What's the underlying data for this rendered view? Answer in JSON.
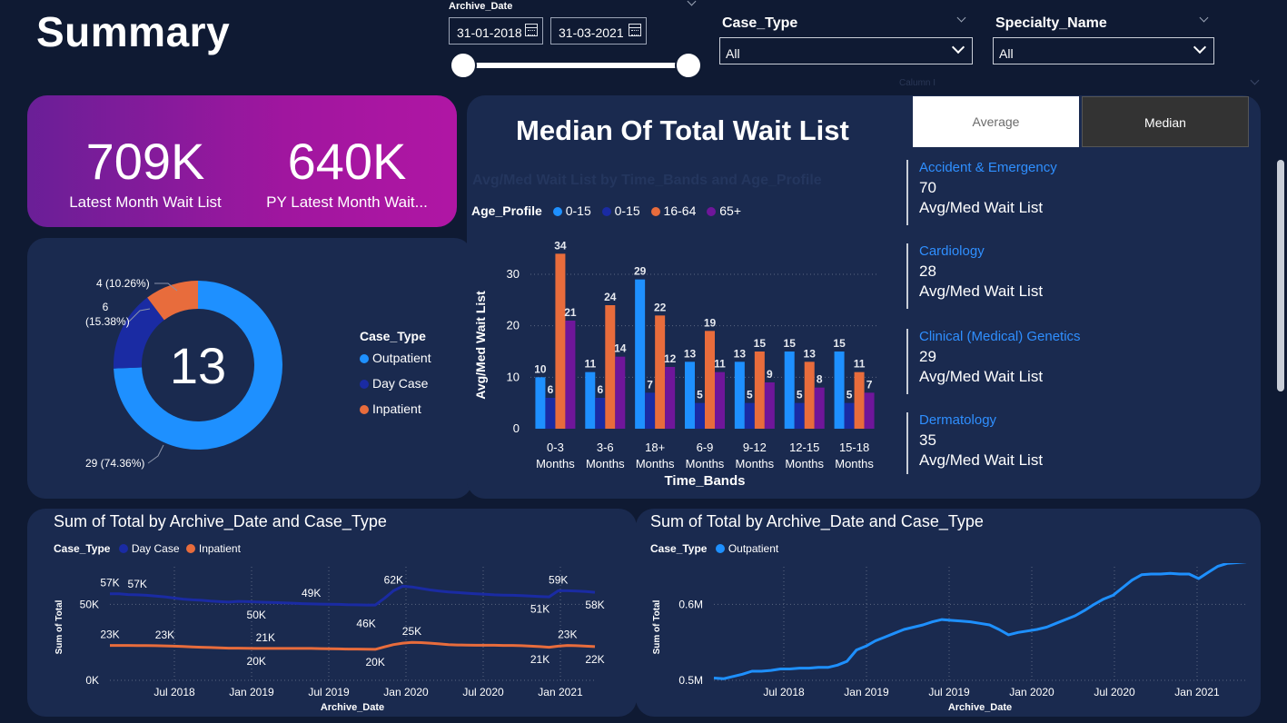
{
  "page_title": "Summary",
  "filters": {
    "archive_date": {
      "label": "Archive_Date",
      "start": "31-01-2018",
      "end": "31-03-2021"
    },
    "case_type": {
      "label": "Case_Type",
      "value": "All"
    },
    "specialty_name": {
      "label": "Specialty_Name",
      "value": "All"
    },
    "hidden_slicer_label": "Calumn I"
  },
  "kpis": [
    {
      "value": "709K",
      "label": "Latest Month Wait List"
    },
    {
      "value": "640K",
      "label": "PY Latest Month Wait..."
    }
  ],
  "donut": {
    "center_value": "13",
    "legend_title": "Case_Type",
    "segments": [
      {
        "name": "Outpatient",
        "value": 29,
        "label": "29 (74.36%)",
        "color": "#1e90ff"
      },
      {
        "name": "Day Case",
        "value": 6,
        "label": "6\n(15.38%)",
        "color": "#1a2ba3"
      },
      {
        "name": "Inpatient",
        "value": 4,
        "label": "4 (10.26%)",
        "color": "#e86c3c"
      }
    ]
  },
  "median_panel": {
    "heading": "Median Of Total Wait List",
    "ghost_title": "Avg/Med Wait List by Time_Bands and Age_Profile",
    "toggle": {
      "average": "Average",
      "median": "Median"
    },
    "specialties": [
      {
        "name": "Accident & Emergency",
        "value": "70",
        "label": "Avg/Med Wait List"
      },
      {
        "name": "Cardiology",
        "value": "28",
        "label": "Avg/Med Wait List"
      },
      {
        "name": "Clinical (Medical) Genetics",
        "value": "29",
        "label": "Avg/Med Wait List"
      },
      {
        "name": "Dermatology",
        "value": "35",
        "label": "Avg/Med Wait List"
      }
    ]
  },
  "colors": {
    "blue": "#1e90ff",
    "navy": "#1a2ba3",
    "orange": "#e86c3c",
    "purple": "#6f169a",
    "accent_text": "#2f8fff"
  },
  "chart_data": [
    {
      "type": "bar",
      "legend_title": "Age_Profile",
      "xlabel": "Time_Bands",
      "ylabel": "Avg/Med Wait List",
      "categories": [
        "0-3 Months",
        "3-6 Months",
        "18+ Months",
        "6-9 Months",
        "9-12 Months",
        "12-15 Months",
        "15-18 Months"
      ],
      "category_lines": [
        [
          "0-3",
          "Months"
        ],
        [
          "3-6",
          "Months"
        ],
        [
          "18+",
          "Months"
        ],
        [
          "6-9",
          "Months"
        ],
        [
          "9-12",
          "Months"
        ],
        [
          "12-15",
          "Months"
        ],
        [
          "15-18",
          "Months"
        ]
      ],
      "ylim": [
        0,
        36
      ],
      "yticks": [
        0,
        10,
        20,
        30
      ],
      "series": [
        {
          "name": "0-15",
          "color": "#1e90ff",
          "values": [
            10,
            11,
            29,
            13,
            13,
            15,
            15
          ]
        },
        {
          "name": "0-15",
          "color": "#1a2ba3",
          "values": [
            6,
            6,
            7,
            5,
            5,
            5,
            5
          ]
        },
        {
          "name": "16-64",
          "color": "#e86c3c",
          "values": [
            34,
            24,
            22,
            19,
            15,
            13,
            11
          ]
        },
        {
          "name": "65+",
          "color": "#6f169a",
          "values": [
            21,
            14,
            12,
            11,
            9,
            8,
            7
          ]
        }
      ]
    },
    {
      "type": "line",
      "title": "Sum of Total by Archive_Date and Case_Type",
      "legend_title": "Case_Type",
      "xlabel": "Archive_Date",
      "ylabel": "Sum of Total",
      "xticks": [
        "Jul 2018",
        "Jan 2019",
        "Jul 2019",
        "Jan 2020",
        "Jul 2020",
        "Jan 2021"
      ],
      "yticks": [
        {
          "value": 0,
          "label": "0K"
        },
        {
          "value": 50000,
          "label": "50K"
        }
      ],
      "ylim": [
        0,
        70000
      ],
      "series": [
        {
          "name": "Day Case",
          "color": "#1a2ba3",
          "values": [
            57000,
            57000,
            56500,
            56300,
            56000,
            55500,
            55000,
            54200,
            53500,
            53000,
            52700,
            52200,
            51800,
            51500,
            52000,
            51800,
            51600,
            51400,
            51200,
            51000,
            50800,
            50500,
            50300,
            50200,
            50100,
            50000,
            49800,
            49700,
            49600,
            49600,
            54000,
            59000,
            62000,
            61500,
            60500,
            59500,
            58800,
            58200,
            57800,
            57400,
            57000,
            56700,
            56300,
            56100,
            56000,
            55800,
            55500,
            55200,
            55000,
            59000,
            59000,
            58800,
            58500,
            58000
          ]
        },
        {
          "name": "Inpatient",
          "color": "#e86c3c",
          "values": [
            23000,
            23000,
            23000,
            22900,
            22900,
            22800,
            22700,
            22500,
            22300,
            22000,
            21800,
            21600,
            21400,
            21200,
            21200,
            21100,
            21000,
            21000,
            21000,
            21000,
            21000,
            21000,
            21000,
            20900,
            20800,
            20700,
            20600,
            20600,
            20500,
            20400,
            22000,
            23500,
            24500,
            25000,
            24800,
            24500,
            24000,
            23500,
            23300,
            23200,
            23100,
            23100,
            23100,
            23000,
            23000,
            22800,
            22500,
            22200,
            21800,
            22500,
            23000,
            22800,
            22500,
            22200
          ]
        }
      ],
      "point_labels": [
        {
          "series": 0,
          "index": 0,
          "text": "57K",
          "pos": "above"
        },
        {
          "series": 0,
          "index": 3,
          "text": "57K",
          "pos": "above"
        },
        {
          "series": 0,
          "index": 16,
          "text": "50K",
          "pos": "below"
        },
        {
          "series": 0,
          "index": 22,
          "text": "49K",
          "pos": "above"
        },
        {
          "series": 0,
          "index": 31,
          "text": "62K",
          "pos": "above"
        },
        {
          "series": 0,
          "index": 47,
          "text": "51K",
          "pos": "below"
        },
        {
          "series": 0,
          "index": 49,
          "text": "59K",
          "pos": "above"
        },
        {
          "series": 0,
          "index": 53,
          "text": "58K",
          "pos": "below"
        },
        {
          "series": 1,
          "index": 0,
          "text": "23K",
          "pos": "above"
        },
        {
          "series": 1,
          "index": 6,
          "text": "23K",
          "pos": "above"
        },
        {
          "series": 1,
          "index": 16,
          "text": "20K",
          "pos": "below"
        },
        {
          "series": 1,
          "index": 17,
          "text": "21K",
          "pos": "above"
        },
        {
          "series": 1,
          "index": 29,
          "text": "20K",
          "pos": "below"
        },
        {
          "series": 1,
          "index": 28,
          "text": "46K",
          "pos": "above_far"
        },
        {
          "series": 1,
          "index": 33,
          "text": "25K",
          "pos": "above"
        },
        {
          "series": 1,
          "index": 47,
          "text": "21K",
          "pos": "below"
        },
        {
          "series": 1,
          "index": 50,
          "text": "23K",
          "pos": "above"
        },
        {
          "series": 1,
          "index": 53,
          "text": "22K",
          "pos": "below"
        }
      ]
    },
    {
      "type": "line",
      "title": "Sum of Total by Archive_Date and Case_Type",
      "legend_title": "Case_Type",
      "xlabel": "Archive_Date",
      "ylabel": "Sum of Total",
      "xticks": [
        "Jul 2018",
        "Jan 2019",
        "Jul 2019",
        "Jan 2020",
        "Jul 2020",
        "Jan 2021"
      ],
      "yticks": [
        {
          "value": 500000,
          "label": "0.5M"
        },
        {
          "value": 600000,
          "label": "0.6M"
        }
      ],
      "ylim": [
        500000,
        640000
      ],
      "series": [
        {
          "name": "Outpatient",
          "color": "#1e90ff",
          "values": [
            503000,
            502000,
            505000,
            508000,
            512000,
            512000,
            513000,
            515000,
            515000,
            516000,
            516000,
            517000,
            517000,
            520000,
            525000,
            540000,
            545000,
            552000,
            557000,
            562000,
            567000,
            570000,
            573000,
            577000,
            580000,
            579000,
            578000,
            577000,
            575000,
            573000,
            567000,
            560000,
            563000,
            565000,
            567000,
            570000,
            575000,
            580000,
            585000,
            592000,
            600000,
            607000,
            612000,
            622000,
            632000,
            639000,
            640000,
            640000,
            641000,
            640000,
            640000,
            634000,
            642000,
            650000,
            654000,
            655000,
            656000
          ]
        }
      ]
    }
  ]
}
